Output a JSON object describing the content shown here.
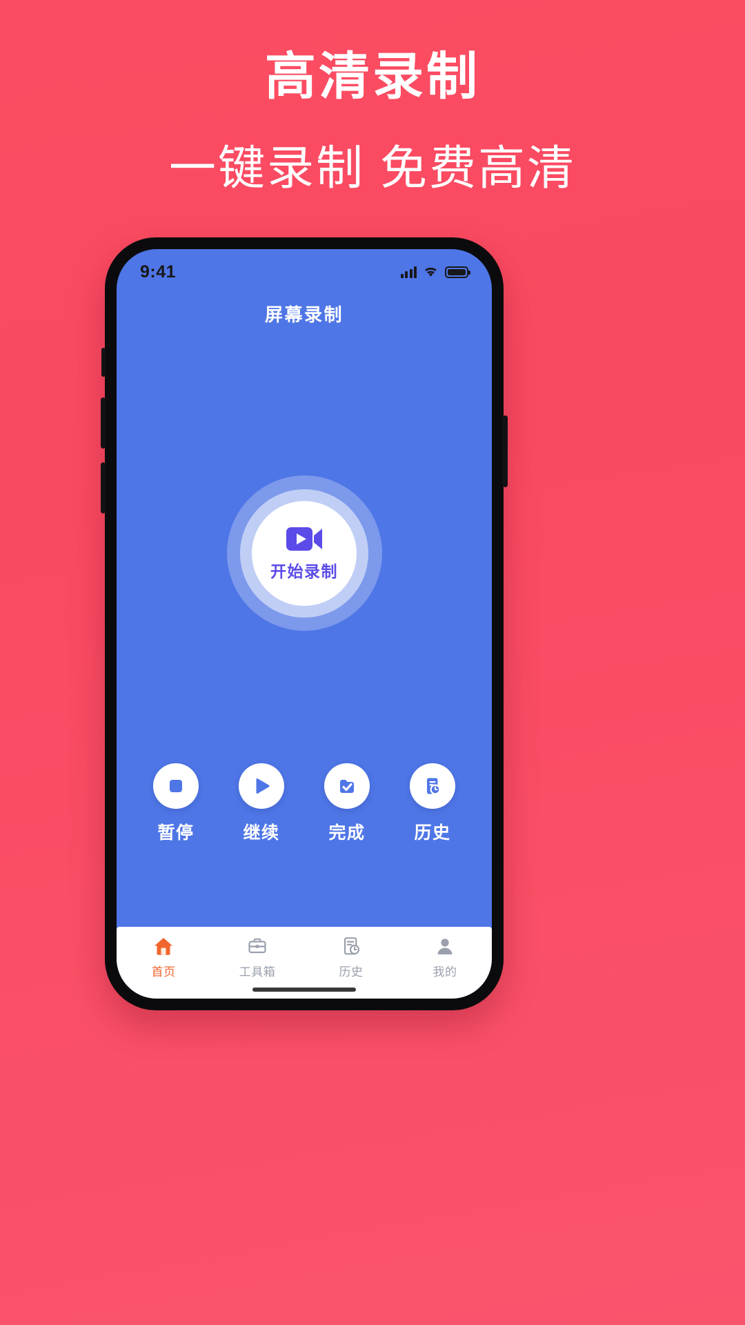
{
  "promo": {
    "title": "高清录制",
    "subtitle": "一键录制 免费高清",
    "background_color": "#FB4C63",
    "text_color": "#FFFFFF"
  },
  "phone": {
    "frame_color": "#0B0B0D",
    "screen_background": "#4F76E6"
  },
  "status_bar": {
    "time": "9:41",
    "signal_icon": "cellular-signal-icon",
    "wifi_icon": "wifi-icon",
    "battery_icon": "battery-icon"
  },
  "app_bar": {
    "title": "屏幕录制"
  },
  "record_button": {
    "label": "开始录制",
    "icon": "video-camera-icon",
    "icon_color": "#5B4BE8",
    "core_color": "#FFFFFF"
  },
  "actions": [
    {
      "label": "暂停",
      "icon": "stop-square-icon"
    },
    {
      "label": "继续",
      "icon": "play-triangle-icon"
    },
    {
      "label": "完成",
      "icon": "document-check-icon"
    },
    {
      "label": "历史",
      "icon": "document-clock-icon"
    }
  ],
  "tabs": [
    {
      "label": "首页",
      "icon": "home-icon",
      "active": true
    },
    {
      "label": "工具箱",
      "icon": "toolbox-icon",
      "active": false
    },
    {
      "label": "历史",
      "icon": "history-icon",
      "active": false
    },
    {
      "label": "我的",
      "icon": "person-icon",
      "active": false
    }
  ],
  "colors": {
    "accent_blue": "#4F76E6",
    "icon_blue": "#4F76E6",
    "purple": "#5B4BE8",
    "tab_active": "#F1662E",
    "tab_inactive": "#9AA0AC",
    "promo_pink": "#FB4C63"
  }
}
